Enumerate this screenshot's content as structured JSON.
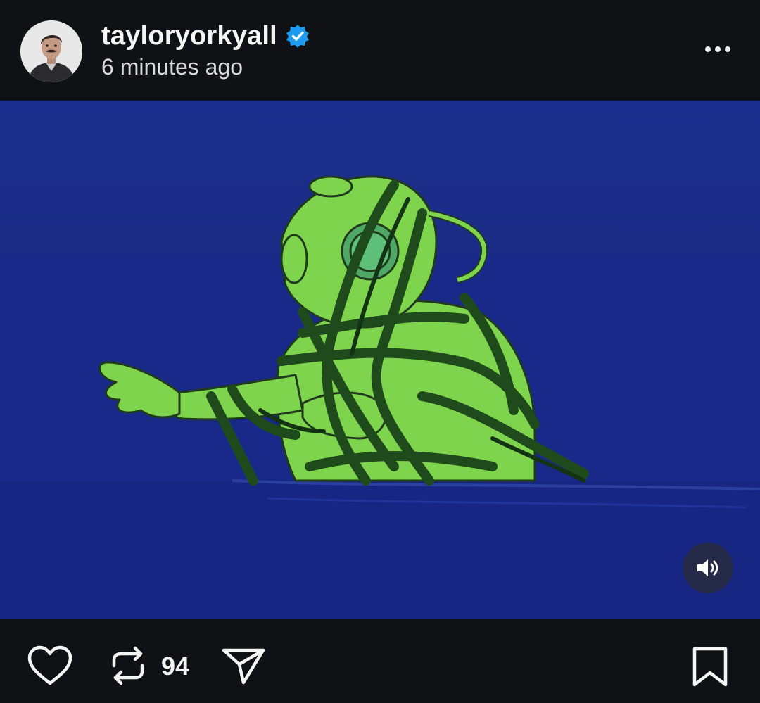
{
  "post": {
    "username": "tayloryorkyall",
    "verified": true,
    "timestamp": "6 minutes ago"
  },
  "media": {
    "type": "video",
    "description_icon": "cartoon-diver-frame",
    "volume_state": "on"
  },
  "actions": {
    "repost_count": "94",
    "icons": [
      "heart-icon",
      "repost-icon",
      "share-icon",
      "bookmark-icon"
    ]
  },
  "colors": {
    "background": "#0f1115",
    "verified_blue": "#1d9bf0",
    "media_blue": "#1a2d8a"
  }
}
